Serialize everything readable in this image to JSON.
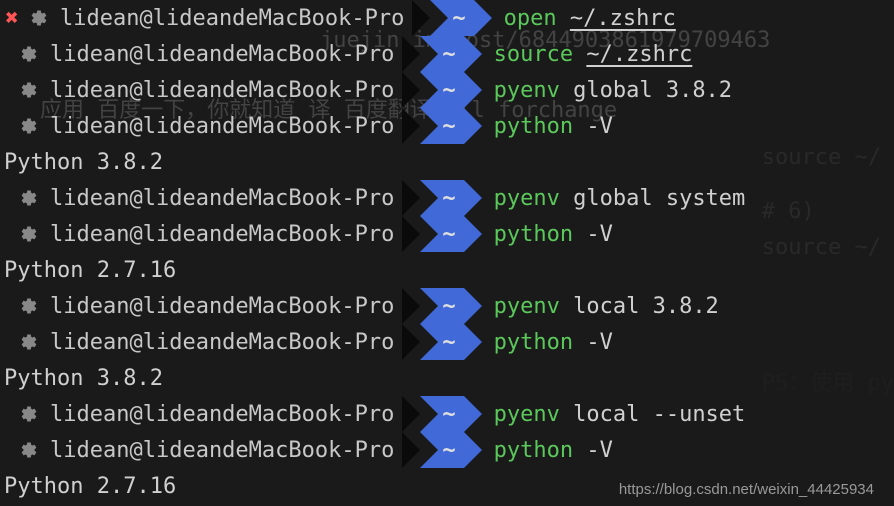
{
  "prompt": {
    "user_host": "lidean@lideandeMacBook-Pro",
    "dir": "~"
  },
  "lines": [
    {
      "type": "cmd",
      "hasClose": true,
      "command": "open",
      "arg": "~/.zshrc",
      "argUnderline": true
    },
    {
      "type": "cmd",
      "hasClose": false,
      "command": "source",
      "arg": "~/.zshrc",
      "argUnderline": true
    },
    {
      "type": "cmd",
      "hasClose": false,
      "command": "pyenv",
      "arg": "global 3.8.2",
      "argUnderline": false
    },
    {
      "type": "cmd",
      "hasClose": false,
      "command": "python",
      "arg": "-V",
      "argUnderline": false
    },
    {
      "type": "out",
      "text": "Python 3.8.2"
    },
    {
      "type": "cmd",
      "hasClose": false,
      "command": "pyenv",
      "arg": "global system",
      "argUnderline": false
    },
    {
      "type": "cmd",
      "hasClose": false,
      "command": "python",
      "arg": "-V",
      "argUnderline": false
    },
    {
      "type": "out",
      "text": "Python 2.7.16"
    },
    {
      "type": "cmd",
      "hasClose": false,
      "command": "pyenv",
      "arg": "local 3.8.2",
      "argUnderline": false
    },
    {
      "type": "cmd",
      "hasClose": false,
      "command": "python",
      "arg": "-V",
      "argUnderline": false
    },
    {
      "type": "out",
      "text": "Python 3.8.2"
    },
    {
      "type": "cmd",
      "hasClose": false,
      "command": "pyenv",
      "arg": "local --unset",
      "argUnderline": false
    },
    {
      "type": "cmd",
      "hasClose": false,
      "command": "python",
      "arg": "-V",
      "argUnderline": false
    },
    {
      "type": "out",
      "text": "Python 2.7.16"
    }
  ],
  "background": {
    "url_fragment": "juejin.im/post/6844903861979709463",
    "nav_items": "应用    百度一下，你就知道    译  百度翻译    all    forchange",
    "side_1": "source ~/",
    "side_2": "# 6)",
    "side_3": "source ~/",
    "side_4": "PS：使用 py"
  },
  "watermark": "https://blog.csdn.net/weixin_44425934"
}
